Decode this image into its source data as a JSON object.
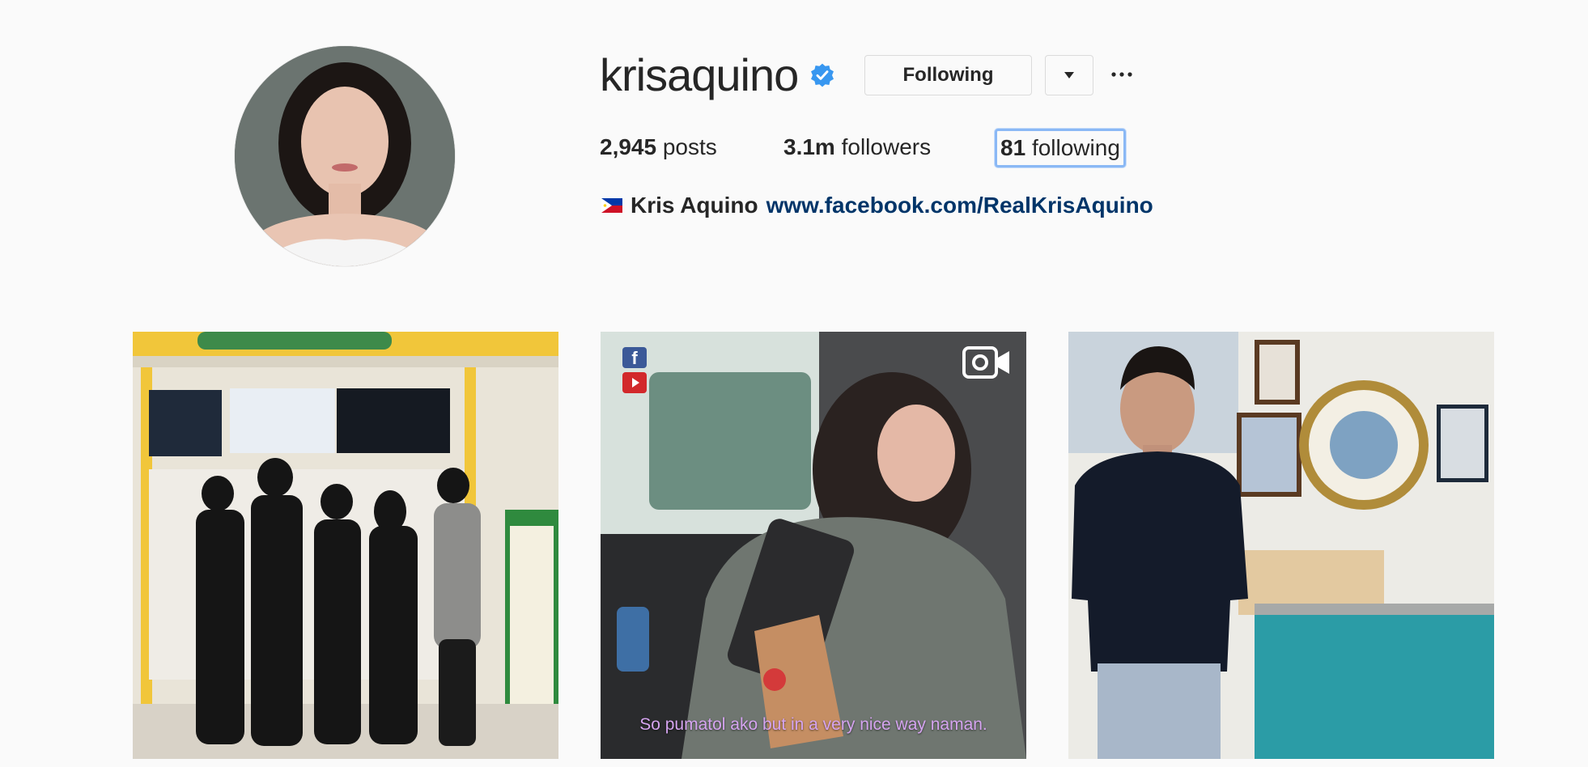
{
  "profile": {
    "username": "krisaquino",
    "verified": true,
    "following_button_label": "Following",
    "more_label": "···",
    "stats": {
      "posts_count": "2,945",
      "posts_label": "posts",
      "followers_count": "3.1m",
      "followers_label": "followers",
      "following_count": "81",
      "following_label": "following"
    },
    "bio": {
      "flag_icon": "philippines-flag-icon",
      "full_name": "Kris Aquino",
      "link": "www.facebook.com/RealKrisAquino"
    }
  },
  "posts": [
    {
      "type": "photo",
      "alt": ""
    },
    {
      "type": "video",
      "caption": "So pumatol ako but in a very nice way naman.",
      "badges": [
        "facebook-icon",
        "youtube-icon"
      ]
    },
    {
      "type": "photo",
      "alt": ""
    }
  ],
  "colors": {
    "background": "#fafafa",
    "text": "#262626",
    "link": "#003569",
    "verified_blue": "#3897f0",
    "border": "#dbdbdb",
    "focus_outline": "#8ab8f5"
  }
}
